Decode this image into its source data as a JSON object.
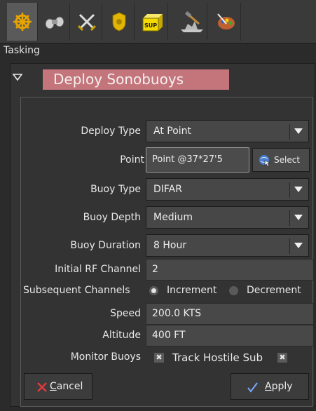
{
  "toolbar": {
    "icons": [
      "helm-wheel-icon",
      "binoculars-icon",
      "crossed-swords-icon",
      "badge-icon",
      "supply-crate-icon",
      "ship-construction-icon",
      "artist-palette-icon"
    ],
    "supply_label": "SUP"
  },
  "tasking": {
    "label": "Tasking"
  },
  "panel": {
    "title": "Deploy Sonobuoys",
    "header_color": "#c4757c"
  },
  "form": {
    "deploy_type": {
      "label": "Deploy Type",
      "value": "At Point"
    },
    "point": {
      "label": "Point",
      "value": "Point  @37*27'5",
      "select_label": "Select"
    },
    "buoy_type": {
      "label": "Buoy Type",
      "value": "DIFAR"
    },
    "buoy_depth": {
      "label": "Buoy Depth",
      "value": "Medium"
    },
    "buoy_duration": {
      "label": "Buoy Duration",
      "value": "8 Hour"
    },
    "initial_rf_channel": {
      "label": "Initial RF Channel",
      "value": "2"
    },
    "subsequent_channels": {
      "label": "Subsequent Channels",
      "options": [
        "Increment",
        "Decrement"
      ],
      "selected": "Increment"
    },
    "speed": {
      "label": "Speed",
      "value": "200.0 KTS"
    },
    "altitude": {
      "label": "Altitude",
      "value": "400 FT"
    },
    "monitor_buoys": {
      "label": "Monitor Buoys",
      "checked": false
    },
    "track_hostile_sub": {
      "label": "Track Hostile Sub",
      "checked": false
    }
  },
  "actions": {
    "cancel_label_first": "C",
    "cancel_label_rest": "ancel",
    "apply_label_first": "A",
    "apply_label_rest": "pply"
  }
}
